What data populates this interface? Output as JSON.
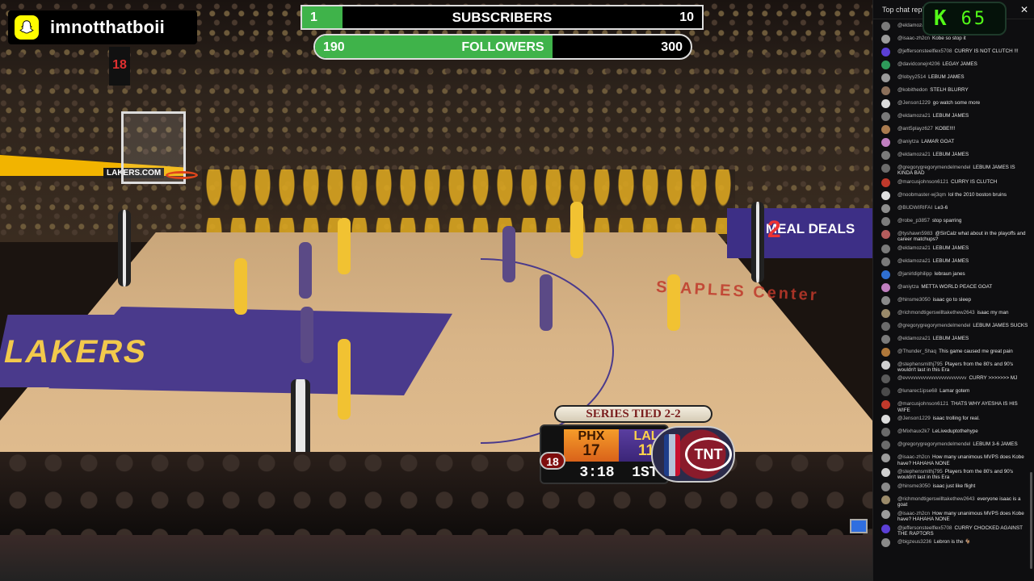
{
  "overlay": {
    "snapchat_handle": "imnotthatboii",
    "subscribers": {
      "current": "1",
      "label": "SUBSCRIBERS",
      "goal": "10",
      "progress": 0.1
    },
    "followers": {
      "current": "190",
      "label": "FOLLOWERS",
      "goal": "300",
      "progress": 0.633
    },
    "kick": {
      "logo": "K",
      "viewer_count": "65"
    }
  },
  "broadcast": {
    "series_banner": "SERIES TIED 2-2",
    "away_team": {
      "abbr": "PHX",
      "score": "17"
    },
    "home_team": {
      "abbr": "LAL",
      "score": "11"
    },
    "shot_clock": "18",
    "game_clock": "3:18",
    "quarter": "1ST",
    "network": "TNT",
    "shot_clock_display": "18",
    "arena_text": "STAPLES Center",
    "ad_text": "MEAL DEALS",
    "ad_number": "2",
    "court_text": "LAKERS",
    "rail_text": "LAKERS.COM"
  },
  "chat": {
    "header": "Top chat replay",
    "close_icon": "close-icon",
    "messages": [
      {
        "user": "@eldamoza21",
        "text": "",
        "color": "#7a7a7a"
      },
      {
        "user": "@isaac-zh2cn",
        "text": "Kobe so stop it",
        "color": "#9b9b9b"
      },
      {
        "user": "@jeffersonsteelflex5708",
        "text": "CURRY IS NOT CLUTCH !!!",
        "color": "#5b3fd6"
      },
      {
        "user": "@davidconejr4206",
        "text": "LEGAY JAMES",
        "color": "#2e9b5a"
      },
      {
        "user": "@lobyy2514",
        "text": "LEBUM JAMES",
        "color": "#9a9a9a"
      },
      {
        "user": "@kobithedon",
        "text": "STELH BLURRY",
        "color": "#8a6f5a"
      },
      {
        "user": "@Jenson1229",
        "text": "go watch some more",
        "color": "#dcdcdc"
      },
      {
        "user": "@eldamoza21",
        "text": "LEBUM JAMES",
        "color": "#7a7a7a"
      },
      {
        "user": "@ant5playz627",
        "text": "KOBE!!!!",
        "color": "#a97b4f"
      },
      {
        "user": "@aniytza",
        "text": "LAMAR GOAT",
        "color": "#c07fc0"
      },
      {
        "user": "@eldamoza21",
        "text": "LEBUM JAMES",
        "color": "#7a7a7a"
      },
      {
        "user": "@gregorygregorymendelmendel",
        "text": "LEBUM JAMES IS KINDA BAD",
        "color": "#6b6b6b"
      },
      {
        "user": "@marcusjohnson6121",
        "text": "CURRY IS CLUTCH",
        "color": "#c0392b"
      },
      {
        "user": "@noobmaster-wj3qm",
        "text": "lol the 2010 boston bruins",
        "color": "#e0e0e0"
      },
      {
        "user": "@BUDWIRIFAI",
        "text": "Le3-6",
        "color": "#8d8d8d"
      },
      {
        "user": "@robe_p3857",
        "text": "stop sparring",
        "color": "#7c7c7c"
      },
      {
        "user": "@tyshawn5983",
        "text": "@SirCalz what about in the playoffs and career matchups?",
        "color": "#b45c5c"
      },
      {
        "user": "@eldamoza21",
        "text": "LEBUM JAMES",
        "color": "#7a7a7a"
      },
      {
        "user": "@eldamoza21",
        "text": "LEBUM JAMES",
        "color": "#7a7a7a"
      },
      {
        "user": "@janirldiphilipp",
        "text": "lebraun janes",
        "color": "#2f6fd1"
      },
      {
        "user": "@aniytza",
        "text": "METTA WORLD PEACE GOAT",
        "color": "#c07fc0"
      },
      {
        "user": "@hinsme3050",
        "text": "isaac go to sleep",
        "color": "#8a8a8a"
      },
      {
        "user": "@richmondtigerswilltakethew2643",
        "text": "isaac my man",
        "color": "#9a8a6a"
      },
      {
        "user": "@gregorygregorymendelmendel",
        "text": "LEBUM JAMES SUCKS",
        "color": "#6b6b6b"
      },
      {
        "user": "@eldamoza21",
        "text": "LEBUM JAMES",
        "color": "#7a7a7a"
      },
      {
        "user": "@Thunder_Shaq",
        "text": "This game caused me great pain",
        "color": "#b0783a"
      },
      {
        "user": "@stephensmithj795",
        "text": "Players from the 80's and 90's wouldn't last in this Era",
        "color": "#d0d0d0"
      },
      {
        "user": "@evvvvvvvvvvvvvvvvvvvvvvvv",
        "text": "CURRY >>>>>>> MJ",
        "color": "#5a5a5a"
      },
      {
        "user": "@lunarec1ipse68",
        "text": "Lamar gotem",
        "color": "#4a4a4a"
      },
      {
        "user": "@marcusjohnson6121",
        "text": "THATS WHY AYESHA IS HIS WIFE",
        "color": "#c0392b"
      },
      {
        "user": "@Jenson1229",
        "text": "isaac trolling for real.",
        "color": "#dcdcdc"
      },
      {
        "user": "@Mixhaux2k7",
        "text": "LeLiveduptothehype",
        "color": "#6a6a6a"
      },
      {
        "user": "@gregorygregorymendelmendel",
        "text": "LEBUM 3-6 JAMES",
        "color": "#6b6b6b"
      },
      {
        "user": "@isaac-zh2cn",
        "text": "How many unanimous MVPS does Kobe have? HAHAHA NONE",
        "color": "#9b9b9b"
      },
      {
        "user": "@stephensmithj795",
        "text": "Players from the 80's and 90's wouldn't last in this Era",
        "color": "#d0d0d0"
      },
      {
        "user": "@hinsme3050",
        "text": "isaac just like flight",
        "color": "#8a8a8a"
      },
      {
        "user": "@richmondtigerswilltakethew2643",
        "text": "everyone isaac is a goat",
        "color": "#9a8a6a"
      },
      {
        "user": "@isaac-zh2cn",
        "text": "How many unanimous MVPS does Kobe have? HAHAHA NONE",
        "color": "#9b9b9b"
      },
      {
        "user": "@jeffersonsteelflex5708",
        "text": "CURRY CHOCKED AGAINST THE RAPTORS",
        "color": "#5b3fd6"
      },
      {
        "user": "@bigzeus3236",
        "text": "Lebron is the 🐐",
        "color": "#8a8a8a"
      }
    ]
  }
}
